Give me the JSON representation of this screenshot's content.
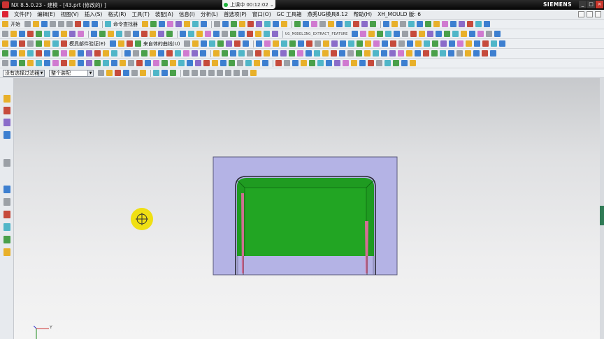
{
  "window": {
    "title": "NX 8.5.0.23 - 建模 - [43.prt  (修改的) ]",
    "brand": "SIEMENS",
    "buttons": [
      "_",
      "□",
      "×"
    ]
  },
  "recording": {
    "text": "上课中 00:12:02 ⌄"
  },
  "menu": {
    "items": [
      "文件(F)",
      "编辑(E)",
      "视图(V)",
      "插入(S)",
      "格式(R)",
      "工具(T)",
      "装配(A)",
      "信息(I)",
      "分析(L)",
      "首选项(P)",
      "窗口(O)",
      "GC 工具箱",
      "燕秀UG模具8.12",
      "帮助(H)",
      "XH_MOULD 版: 6"
    ]
  },
  "toolbars": {
    "start_label": "开始",
    "search_label": "命令查找器",
    "feature_name": "UG_MODELING_EXTRACT_FEATURE",
    "mold_validation": "模具部件验证(E)",
    "curve_from_body": "来自体的曲线(U)"
  },
  "selection": {
    "filter_value": "没有选择过滤器",
    "scope_value": "整个装配"
  },
  "colors": {
    "background_top": "#c7c9cc",
    "background_bottom": "#f4f4f4",
    "block_fill": "#b4b3e5",
    "green_face": "#1f9b21",
    "pink_edge": "#e06b9c",
    "cursor_highlight": "#f0de00"
  },
  "icons": {
    "cursor": "move-crosshair-icon",
    "triad": "wcs-triad-icon"
  },
  "triad": {
    "axis_y": "Y"
  }
}
